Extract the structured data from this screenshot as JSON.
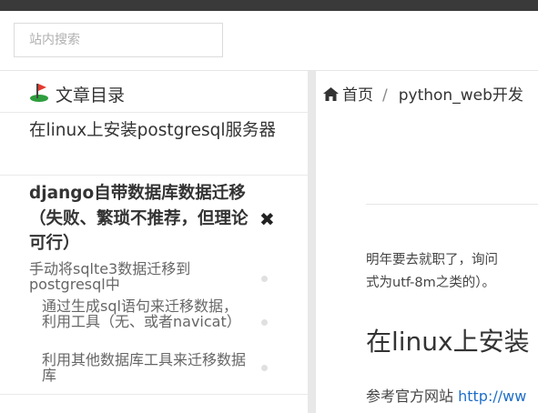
{
  "search": {
    "placeholder": "站内搜索"
  },
  "toc": {
    "title": "文章目录",
    "items": [
      {
        "label": "在linux上安装postgresql服务器"
      },
      {
        "label": "django自带数据库数据迁移（失败、繁琐不推荐，但理论可行）",
        "subitems": [
          {
            "label": "手动将sqlte3数据迁移到postgresql中"
          },
          {
            "label": "通过生成sql语句来迁移数据，利用工具（无、或者navicat）"
          },
          {
            "label": "利用其他数据库工具来迁移数据库"
          }
        ]
      }
    ]
  },
  "breadcrumb": {
    "home": "首页",
    "separator": "/",
    "current": "python_web开发"
  },
  "article": {
    "para1_line1": "明年要去就职了，询问",
    "para1_line2": "式为utf-8m之类的）。",
    "heading": "在linux上安装",
    "para2_text": "参考官方网站 ",
    "para2_link": "http://ww"
  },
  "colors": {
    "link": "#1e6ec8",
    "topbar": "#3a3a3a",
    "divider": "#e8e8e8"
  },
  "icons": {
    "toc": "flag-icon",
    "home": "home-icon",
    "close": "close-icon"
  }
}
